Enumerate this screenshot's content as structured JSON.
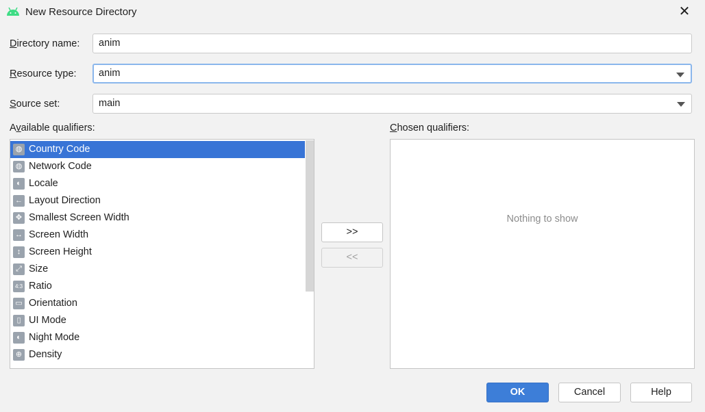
{
  "window": {
    "title": "New Resource Directory"
  },
  "form": {
    "directory_name": {
      "mnemonic": "D",
      "rest": "irectory name:",
      "value": "anim"
    },
    "resource_type": {
      "mnemonic": "R",
      "rest": "esource type:",
      "value": "anim"
    },
    "source_set": {
      "mnemonic": "S",
      "rest": "ource set:",
      "value": "main"
    }
  },
  "available": {
    "pre": "A",
    "mnemonic": "v",
    "rest": "ailable qualifiers:",
    "items": [
      {
        "label": "Country Code",
        "glyph": "◍"
      },
      {
        "label": "Network Code",
        "glyph": "◍"
      },
      {
        "label": "Locale",
        "glyph": "◐"
      },
      {
        "label": "Layout Direction",
        "glyph": "←"
      },
      {
        "label": "Smallest Screen Width",
        "glyph": "✥"
      },
      {
        "label": "Screen Width",
        "glyph": "↔"
      },
      {
        "label": "Screen Height",
        "glyph": "↕"
      },
      {
        "label": "Size",
        "glyph": "⤢"
      },
      {
        "label": "Ratio",
        "glyph": "4:3"
      },
      {
        "label": "Orientation",
        "glyph": "▭"
      },
      {
        "label": "UI Mode",
        "glyph": "▯"
      },
      {
        "label": "Night Mode",
        "glyph": "◐"
      },
      {
        "label": "Density",
        "glyph": "⊕"
      }
    ]
  },
  "chosen": {
    "mnemonic": "C",
    "rest": "hosen qualifiers:",
    "empty": "Nothing to show"
  },
  "buttons": {
    "add": ">>",
    "remove": "<<",
    "ok": "OK",
    "cancel": "Cancel",
    "help": "Help"
  }
}
